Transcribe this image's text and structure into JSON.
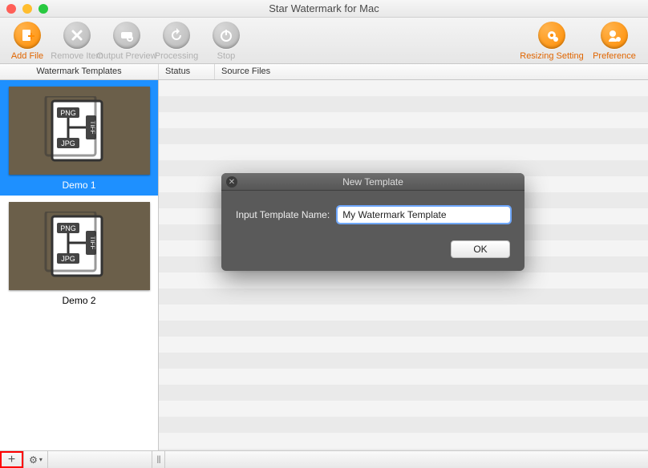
{
  "window": {
    "title": "Star Watermark for Mac"
  },
  "toolbar": {
    "left": [
      {
        "id": "add-file",
        "label": "Add File",
        "disabled": false,
        "icon": "file-plus"
      },
      {
        "id": "remove-item",
        "label": "Remove Item",
        "disabled": true,
        "icon": "x"
      },
      {
        "id": "output-preview",
        "label": "Output Preview",
        "disabled": true,
        "icon": "eye"
      },
      {
        "id": "processing",
        "label": "Processing",
        "disabled": true,
        "icon": "refresh"
      },
      {
        "id": "stop",
        "label": "Stop",
        "disabled": true,
        "icon": "power"
      }
    ],
    "right": [
      {
        "id": "resizing-setting",
        "label": "Resizing Setting",
        "disabled": false,
        "icon": "gear-resize"
      },
      {
        "id": "preference",
        "label": "Preference",
        "disabled": false,
        "icon": "gear-user"
      }
    ]
  },
  "columns": {
    "templates": "Watermark Templates",
    "status": "Status",
    "sources": "Source Files"
  },
  "templates": [
    {
      "name": "Demo 1",
      "selected": true
    },
    {
      "name": "Demo 2",
      "selected": false
    }
  ],
  "thumb_labels": {
    "png": "PNG",
    "jpg": "JPG",
    "tiff": "TIFF"
  },
  "dialog": {
    "title": "New Template",
    "label": "Input Template Name:",
    "value": "My Watermark Template",
    "ok": "OK"
  },
  "bottombar": {
    "add": "+",
    "gear": "⚙",
    "dropdown": "▾"
  }
}
